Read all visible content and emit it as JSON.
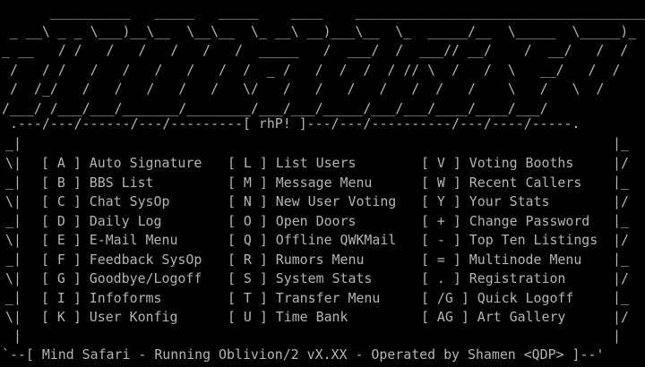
{
  "logo_lines": [
    "      __________   _____   _____    ____    ______________________________________",
    " _ __\\ _ _ \\___)__\\__  \\__\\__  \\_ __\\ __)___\\__  \\_  _____/__  \\_____  \\_____)_",
    "_ __   / /   /   /   /   /   /  _____   /  ___/  /  ___// __/    /  __/   /  /  /",
    " /   / /   /   /   /   /   /  /  _ /   /  /  /  / // \\  /   /  \\   __/   /  /",
    " /  /_/   /   /   /   /   /   \\/   /   /   /   /   /  /   /    \\   /   \\  /",
    "/___/ /___/___/_______/________/___/___/_____/___/___/____/____/___/ ",
    " .---/----/----/---/---------[ rhP! ]---/---/----------/---/---/-----."
  ],
  "frame": {
    "top": " .---/---/------/---/---------[ rhP! ]---/---/----------/---/----/-----.",
    "bottom": "`--[ Mind Safari - Running Oblivion/2 vX.XX - Operated by Shamen <QDP> ]--'"
  },
  "side_left": [
    "_|",
    "\\|",
    "_|",
    "\\|",
    "_|",
    "\\|",
    "_|",
    "\\|",
    "_|",
    "\\|",
    " |"
  ],
  "side_right": [
    "|_",
    "|/",
    "|_",
    "|/",
    "|_",
    "|/",
    "|_",
    "|/",
    "|_",
    "|/",
    "|"
  ],
  "menu": {
    "col1": [
      "[ A ] Auto Signature",
      "[ B ] BBS List",
      "[ C ] Chat SysOp",
      "[ D ] Daily Log",
      "[ E ] E-Mail Menu",
      "[ F ] Feedback SysOp",
      "[ G ] Goodbye/Logoff",
      "[ I ] Infoforms",
      "[ K ] User Konfig"
    ],
    "col2": [
      "[ L ] List Users",
      "[ M ] Message Menu",
      "[ N ] New User Voting",
      "[ O ] Open Doors",
      "[ Q ] Offline QWKMail",
      "[ R ] Rumors Menu",
      "[ S ] System Stats",
      "[ T ] Transfer Menu",
      "[ U ] Time Bank"
    ],
    "col3": [
      "[ V ] Voting Booths",
      "[ W ] Recent Callers",
      "[ Y ] Your Stats",
      "[ + ] Change Password",
      "[ - ] Top Ten Listings",
      "[ = ] Multinode Menu",
      "[ . ] Registration",
      "[ /G ] Quick Logoff",
      "[ AG ] Art Gallery"
    ]
  }
}
